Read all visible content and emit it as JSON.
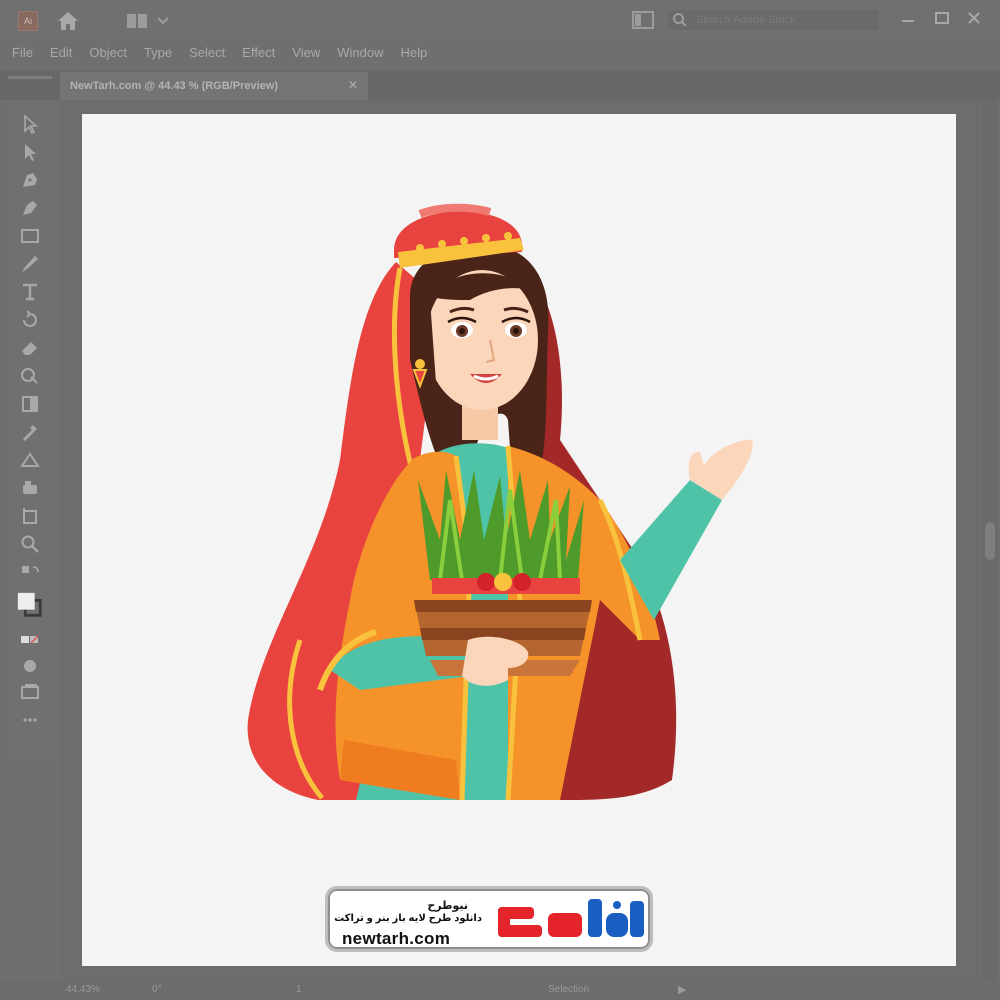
{
  "app": {
    "logo_text": "Ai",
    "search_placeholder": "Search Adobe Stock"
  },
  "menu": [
    "File",
    "Edit",
    "Object",
    "Type",
    "Select",
    "Effect",
    "View",
    "Window",
    "Help"
  ],
  "document_tab": {
    "title": "NewTarh.com @ 44.43 % (RGB/Preview)",
    "close": "✕"
  },
  "statusbar": {
    "zoom": "44.43%",
    "angle": "0°",
    "page": "1",
    "tool": "Selection",
    "play": "▶"
  },
  "watermark": {
    "name": "نیوطرح",
    "tagline": "دانلود طرح لایه باز بنر و تراکت",
    "url": "newtarh.com",
    "logo_text": "نیوطرح"
  },
  "colors": {
    "chrome": "#707070",
    "artboard": "#f4f4f4",
    "hat_red": "#e8433f",
    "jacket_orange": "#f6922a",
    "dress_teal": "#4fc3a8",
    "brand_red": "#e4232a",
    "brand_blue": "#1b5ec2"
  }
}
